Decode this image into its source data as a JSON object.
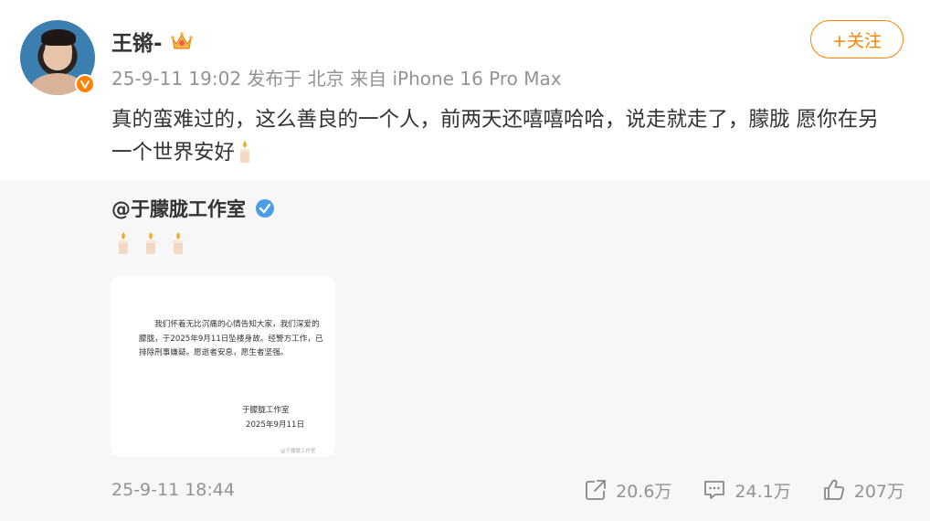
{
  "post": {
    "username": "王锵-",
    "meta": "25-9-11 19:02 发布于 北京 来自 iPhone 16 Pro Max",
    "follow_label": "+关注",
    "text": "真的蛮难过的，这么善良的一个人，前两天还嘻嘻哈哈，说走就走了，朦胧 愿你在另一个世界安好",
    "icons": {
      "verified": "orange-v-badge-icon",
      "member": "crown-icon",
      "emoji": "candle-icon"
    },
    "accent_color": "#ff8200"
  },
  "repost": {
    "author": "@于朦胧工作室",
    "verified_icon": "blue-v-badge-icon",
    "emoji_count": 3,
    "notice": {
      "body": "我们怀着无比沉痛的心情告知大家，我们深爱的朦胧，于2025年9月11日坠楼身故。经警方工作，已排除刑事嫌疑。愿逝者安息，愿生者坚强。",
      "signature": "于朦胧工作室",
      "date": "2025年9月11日",
      "watermark": "@于朦胧工作室"
    },
    "time": "25-9-11 18:44",
    "actions": {
      "share_count": "20.6万",
      "comment_count": "24.1万",
      "like_count": "207万"
    }
  }
}
